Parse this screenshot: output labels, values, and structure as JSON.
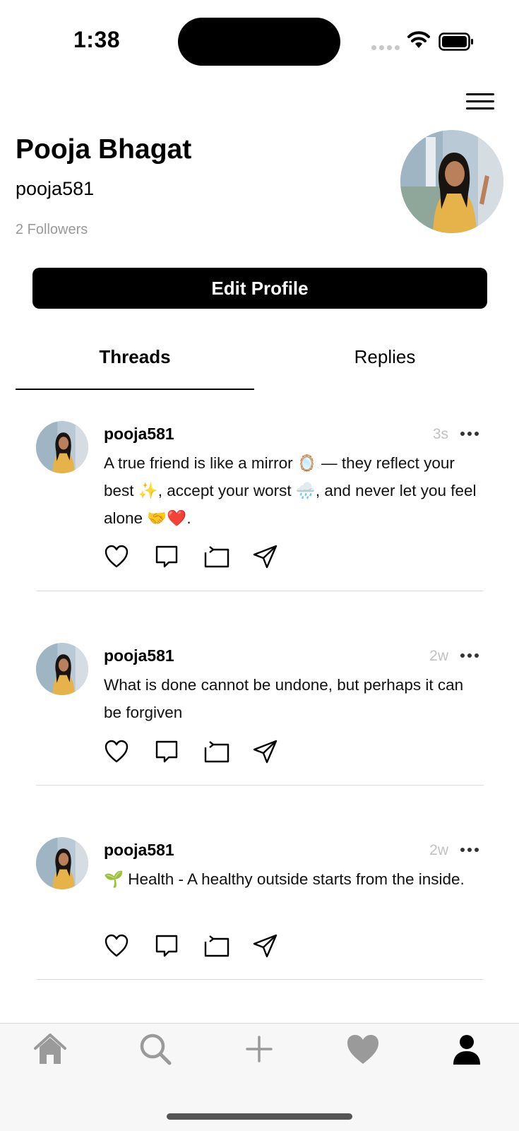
{
  "status_bar": {
    "time": "1:38"
  },
  "profile": {
    "name": "Pooja Bhagat",
    "handle": "pooja581",
    "followers": "2 Followers",
    "edit_button": "Edit Profile"
  },
  "tabs": {
    "threads": "Threads",
    "replies": "Replies",
    "active": "threads"
  },
  "posts": [
    {
      "username": "pooja581",
      "time": "3s",
      "text": "A true friend is like a mirror 🪞 — they reflect your best ✨, accept your worst 🌧️, and never let you feel alone 🤝❤️."
    },
    {
      "username": "pooja581",
      "time": "2w",
      "text": "What is done cannot be undone, but perhaps it can be forgiven"
    },
    {
      "username": "pooja581",
      "time": "2w",
      "text": "🌱 Health - A healthy outside starts from the inside."
    }
  ],
  "icons": {
    "post_actions": [
      "heart-icon",
      "comment-icon",
      "repost-icon",
      "share-icon"
    ],
    "tab_bar": [
      "home-icon",
      "search-icon",
      "plus-icon",
      "heart-icon",
      "profile-icon"
    ]
  },
  "colors": {
    "primary": "#000000",
    "muted": "#999999",
    "inactive_tab_icon": "#9a9a9a"
  }
}
